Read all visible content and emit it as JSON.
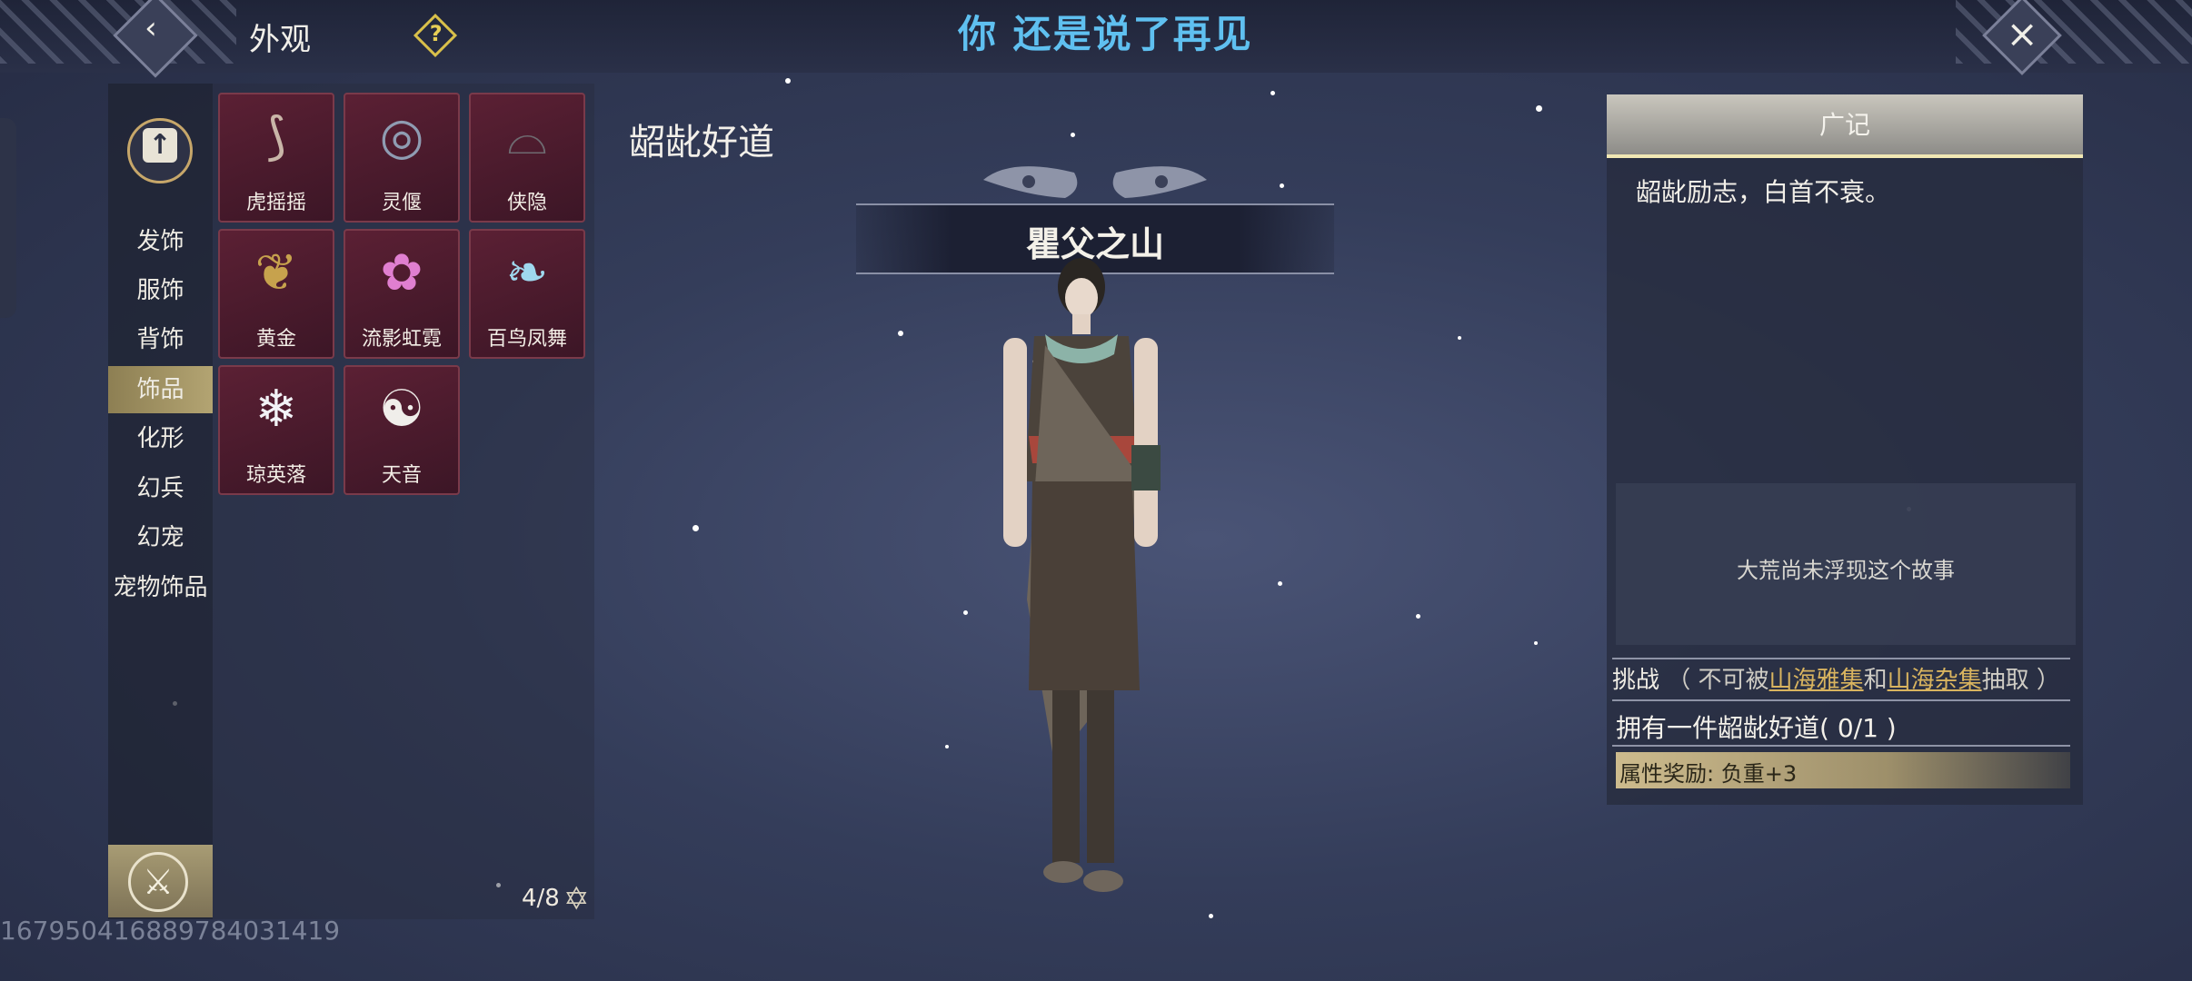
{
  "header": {
    "section_title": "外观",
    "player_name": "你 还是说了再见",
    "back_icon": "back-arrow-icon",
    "help_icon": "question-icon",
    "close_icon": "close-x-icon"
  },
  "sidebar": {
    "tabs": [
      {
        "label": "发饰"
      },
      {
        "label": "服饰"
      },
      {
        "label": "背饰"
      },
      {
        "label": "饰品",
        "active": true
      },
      {
        "label": "化形"
      },
      {
        "label": "幻兵"
      },
      {
        "label": "幻宠"
      },
      {
        "label": "宠物饰品"
      }
    ]
  },
  "items": [
    {
      "label": "虎摇摇",
      "icon": "ribbon-icon"
    },
    {
      "label": "灵偃",
      "icon": "compass-icon"
    },
    {
      "label": "侠隐",
      "icon": "hat-icon"
    },
    {
      "label": "黄金",
      "icon": "gold-ornament-icon"
    },
    {
      "label": "流影虹霓",
      "icon": "rainbow-rings-icon"
    },
    {
      "label": "百鸟凤舞",
      "icon": "phoenix-icon"
    },
    {
      "label": "琼英落",
      "icon": "snowflake-icon"
    },
    {
      "label": "天音",
      "icon": "yin-yang-icon"
    }
  ],
  "pagination": {
    "count": "4/8"
  },
  "watermark": "16795041688978403141​9",
  "outfit": {
    "name": "龆龀好道",
    "banner": "瞿父之山"
  },
  "detail": {
    "header": "广记",
    "quote": "龆龀励志，白首不衰。",
    "story_placeholder": "大荒尚未浮现这个故事",
    "challenge_label": "挑战",
    "challenge_prefix": "（ 不可被",
    "source_a": "山海雅集",
    "joiner": "和",
    "source_b": "山海杂集",
    "challenge_suffix": "抽取 ）",
    "task": "拥有一件龆龀好道( 0/1 )",
    "reward": "属性奖励:  负重+3"
  },
  "colors": {
    "accent_name": "#5fc0f0",
    "gold": "#d9b45f",
    "item_bg": "#5b2034"
  }
}
